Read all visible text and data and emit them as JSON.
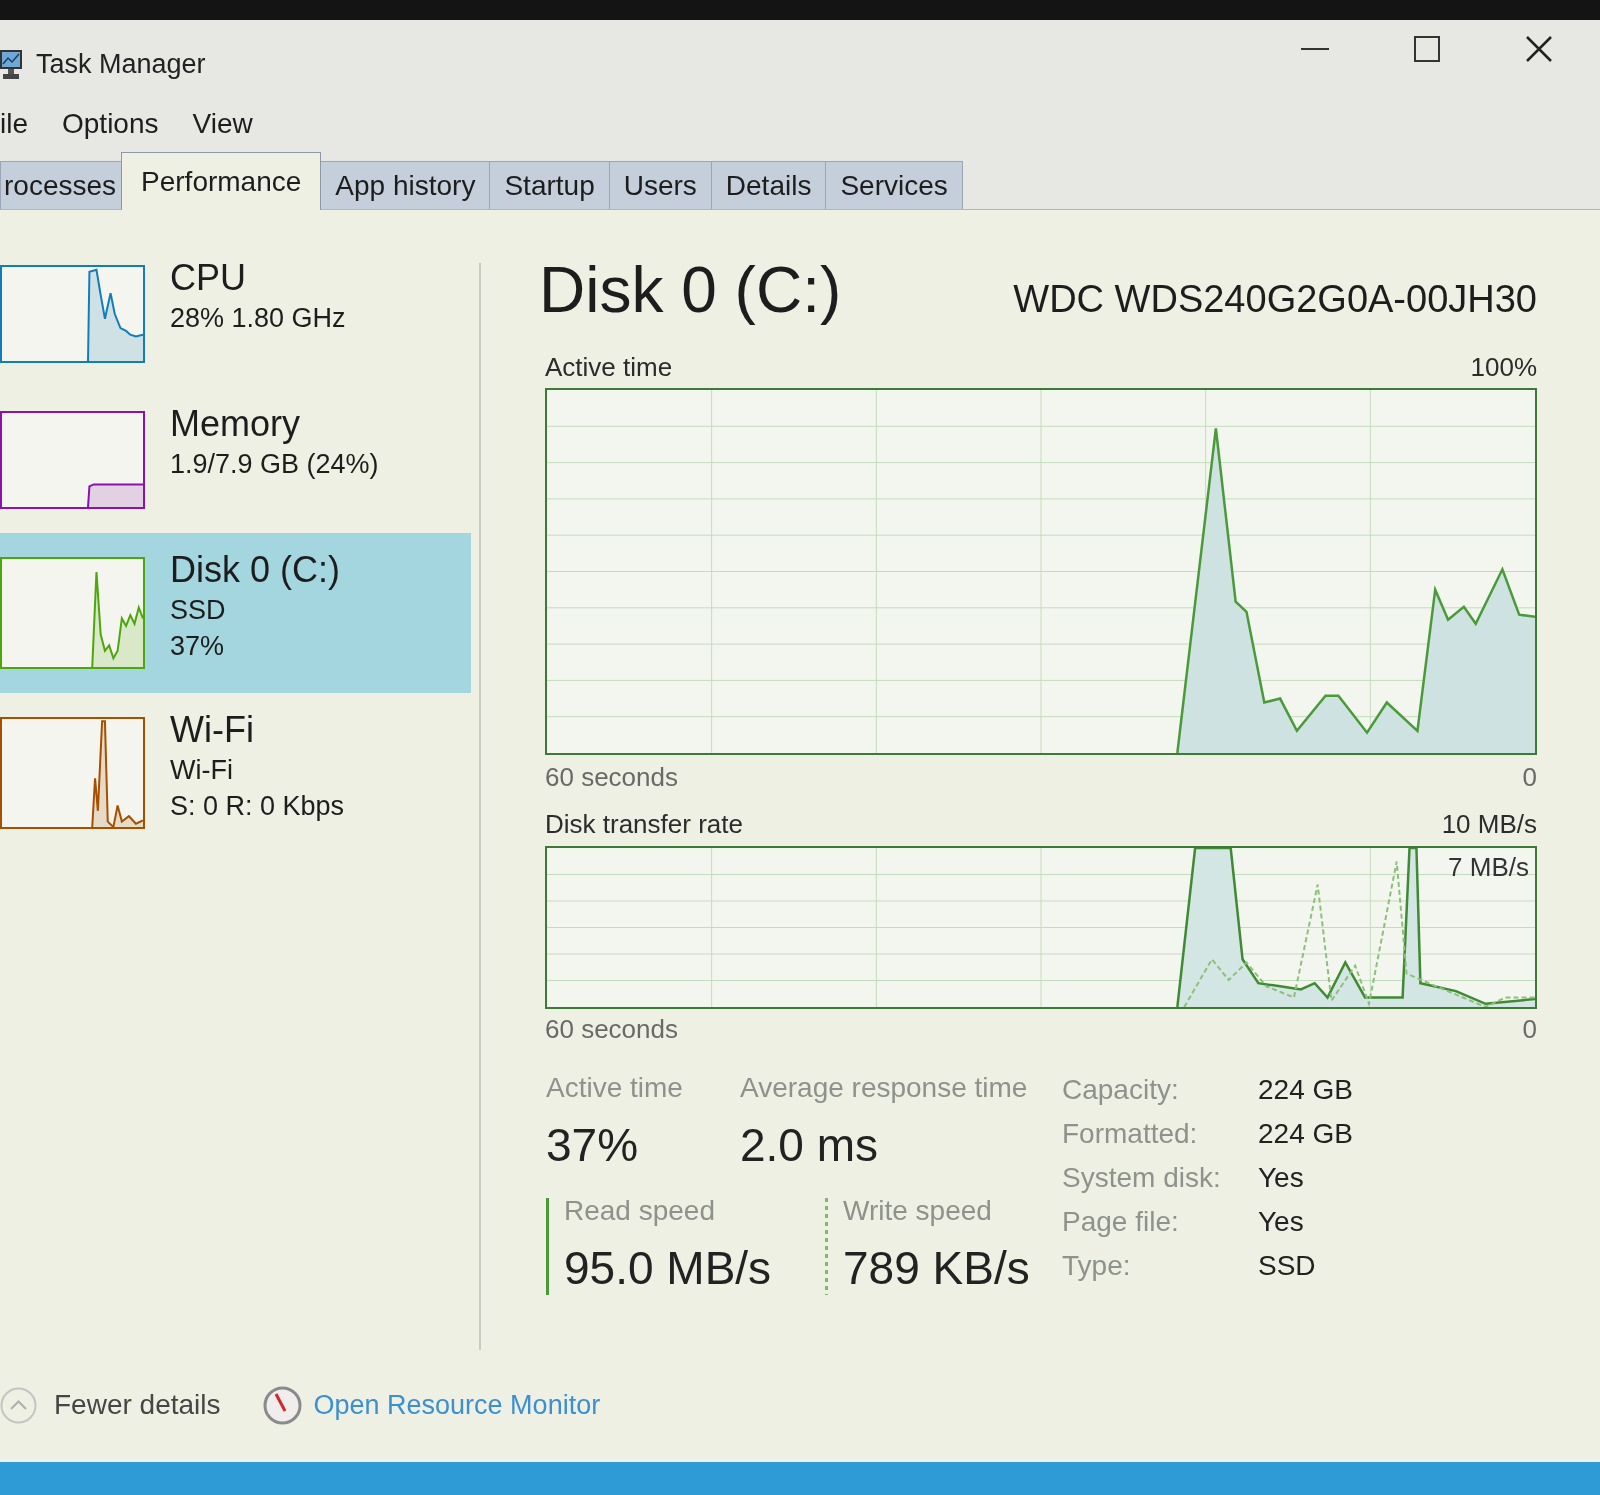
{
  "window": {
    "title": "Task Manager"
  },
  "menu": [
    "ile",
    "Options",
    "View"
  ],
  "tabs": [
    {
      "label": "rocesses",
      "selected": false
    },
    {
      "label": "Performance",
      "selected": true
    },
    {
      "label": "App history",
      "selected": false
    },
    {
      "label": "Startup",
      "selected": false
    },
    {
      "label": "Users",
      "selected": false
    },
    {
      "label": "Details",
      "selected": false
    },
    {
      "label": "Services",
      "selected": false
    }
  ],
  "sidebar": {
    "items": [
      {
        "kind": "cpu",
        "title": "CPU",
        "details": [
          "28% 1.80 GHz"
        ],
        "color": "#117dbb",
        "selected": false
      },
      {
        "kind": "memory",
        "title": "Memory",
        "details": [
          "1.9/7.9 GB (24%)"
        ],
        "color": "#8b12ae",
        "selected": false
      },
      {
        "kind": "disk",
        "title": "Disk 0 (C:)",
        "details": [
          "SSD",
          "37%"
        ],
        "color": "#4da60c",
        "selected": true
      },
      {
        "kind": "network",
        "title": "Wi-Fi",
        "details": [
          "Wi-Fi",
          "S: 0 R: 0 Kbps"
        ],
        "color": "#a74f01",
        "selected": false
      }
    ]
  },
  "detail": {
    "title": "Disk 0 (C:)",
    "model": "WDC WDS240G2G0A-00JH30",
    "graphs": [
      {
        "kind": "active",
        "label": "Active time",
        "max": "100%",
        "span": "60 seconds",
        "end": "0"
      },
      {
        "kind": "transfer",
        "label": "Disk transfer rate",
        "max": "10 MB/s",
        "marker": "7 MB/s",
        "span": "60 seconds",
        "end": "0"
      }
    ],
    "stats": [
      {
        "label": "Active time",
        "value": "37%"
      },
      {
        "label": "Average response time",
        "value": "2.0 ms"
      }
    ],
    "speeds": [
      {
        "kind": "read",
        "label": "Read speed",
        "value": "95.0 MB/s"
      },
      {
        "kind": "write",
        "label": "Write speed",
        "value": "789 KB/s"
      }
    ],
    "properties": [
      {
        "label": "Capacity:",
        "value": "224 GB"
      },
      {
        "label": "Formatted:",
        "value": "224 GB"
      },
      {
        "label": "System disk:",
        "value": "Yes"
      },
      {
        "label": "Page file:",
        "value": "Yes"
      },
      {
        "label": "Type:",
        "value": "SSD"
      }
    ]
  },
  "footer": {
    "fewer_details": "Fewer details",
    "resource_monitor": "Open Resource Monitor"
  }
}
